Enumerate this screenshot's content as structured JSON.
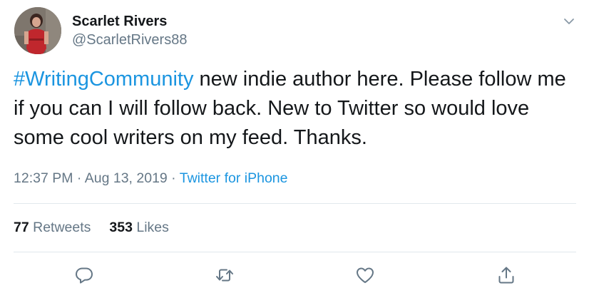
{
  "user": {
    "display_name": "Scarlet Rivers",
    "handle": "@ScarletRivers88"
  },
  "tweet": {
    "hashtag": "#WritingCommunity",
    "body": " new indie author here. Please follow me if you can I will follow back. New to Twitter so would love some cool writers on my feed. Thanks."
  },
  "meta": {
    "time": "12:37 PM",
    "separator": " · ",
    "date": "Aug 13, 2019",
    "source": "Twitter for iPhone"
  },
  "stats": {
    "retweets_count": "77",
    "retweets_label": " Retweets",
    "likes_count": "353",
    "likes_label": " Likes"
  },
  "icons": {
    "reply": "reply-icon",
    "retweet": "retweet-icon",
    "like": "heart-icon",
    "share": "share-icon",
    "caret": "chevron-down-icon"
  },
  "colors": {
    "link": "#1b95e0",
    "text": "#14171a",
    "secondary": "#657786",
    "divider": "#e1e8ed"
  }
}
